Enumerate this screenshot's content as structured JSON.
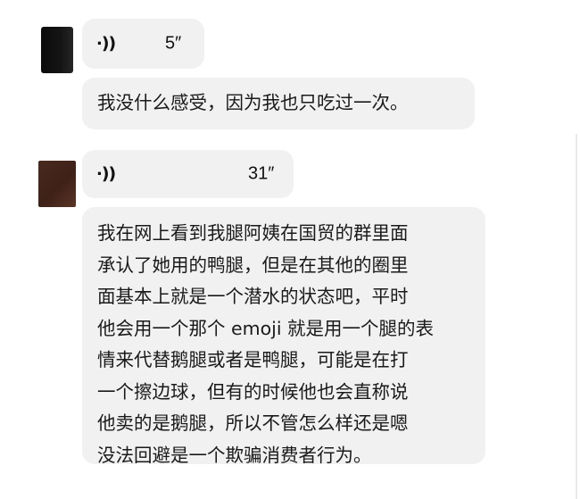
{
  "chat": {
    "messages": [
      {
        "type": "voice",
        "duration": "5″"
      },
      {
        "type": "text",
        "text": "我没什么感受，因为我也只吃过一次。"
      },
      {
        "type": "voice",
        "duration": "31″"
      },
      {
        "type": "text",
        "lines": [
          "我在网上看到我腿阿姨在国贸的群里面",
          "承认了她用的鸭腿，但是在其他的圈里",
          "面基本上就是一个潜水的状态吧，平时",
          "他会用一个那个 emoji 就是用一个腿的表",
          "情来代替鹅腿或者是鸭腿，可能是在打",
          "一个擦边球，但有的时候他也会直称说",
          "他卖的是鹅腿，所以不管怎么样还是嗯",
          "没法回避是一个欺骗消费者行为。"
        ]
      }
    ]
  },
  "icons": {
    "voice": "sound-wave-icon"
  },
  "colors": {
    "bubble": "#f1f1f1",
    "text": "#1a1a1a",
    "background": "#ffffff"
  }
}
